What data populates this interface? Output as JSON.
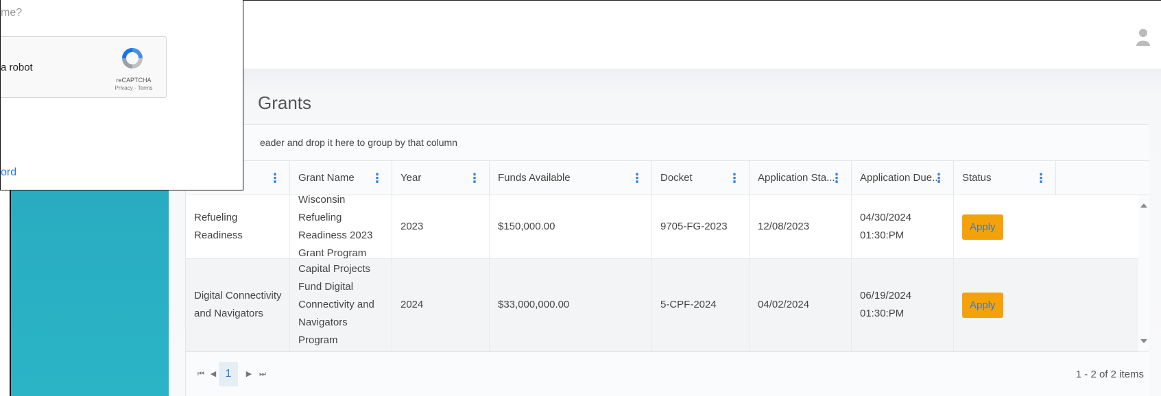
{
  "topbar": {
    "user_icon": "user-icon"
  },
  "page": {
    "title": "Grants"
  },
  "grid": {
    "group_hint": "eader and drop it here to group by that column",
    "columns": [
      {
        "label": ""
      },
      {
        "label": "Grant Name"
      },
      {
        "label": "Year"
      },
      {
        "label": "Funds Available"
      },
      {
        "label": "Docket"
      },
      {
        "label": "Application Sta..."
      },
      {
        "label": "Application Due..."
      },
      {
        "label": "Status"
      }
    ],
    "kebab_glyph": "⋮",
    "rows": [
      {
        "program": "Refueling Readiness",
        "grant_name": "Wisconsin Refueling Readiness 2023 Grant Program",
        "year": "2023",
        "funds": "$150,000.00",
        "docket": "9705-FG-2023",
        "app_start": "12/08/2023",
        "app_due": "04/30/2024 01:30:PM",
        "status_button": "Apply"
      },
      {
        "program": "Digital Connectivity and Navigators",
        "grant_name": "Capital Projects Fund Digital Connectivity and Navigators Program",
        "year": "2024",
        "funds": "$33,000,000.00",
        "docket": "5-CPF-2024",
        "app_start": "04/02/2024",
        "app_due": "06/19/2024 01:30:PM",
        "status_button": "Apply"
      }
    ],
    "pager": {
      "first": "⏮",
      "prev": "◀",
      "current_page": "1",
      "next": "▶",
      "last": "⏭",
      "info": "1 - 2 of 2 items"
    }
  },
  "popup": {
    "question": "me?",
    "robot_label": "a robot",
    "recaptcha_brand": "reCAPTCHA",
    "recaptcha_links": "Privacy - Terms",
    "link_text": "ord"
  },
  "colors": {
    "sidebar": "#2ab4c6",
    "apply_button": "#f5a20a",
    "link_blue": "#2a7de1"
  }
}
